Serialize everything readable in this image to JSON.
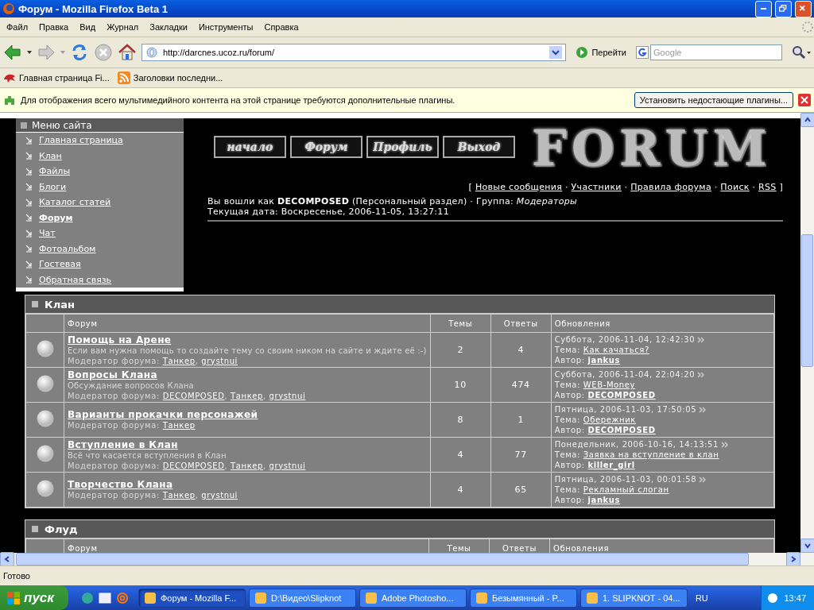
{
  "window": {
    "title": "Форум - Mozilla Firefox Beta 1"
  },
  "menu_bar": [
    "Файл",
    "Правка",
    "Вид",
    "Журнал",
    "Закладки",
    "Инструменты",
    "Справка"
  ],
  "toolbar": {
    "address": "http://darcnes.ucoz.ru/forum/",
    "go_button": "Перейти",
    "search_placeholder": "Google"
  },
  "bookmarks": [
    "Главная страница Fi...",
    "Заголовки последни..."
  ],
  "notification": {
    "message": "Для отображения всего мультимедийного контента на этой странице требуются дополнительные плагины.",
    "button": "Установить недостающие плагины..."
  },
  "site_menu": {
    "title": "Меню сайта",
    "items": [
      {
        "label": "Главная страница",
        "selected": false
      },
      {
        "label": "Клан",
        "selected": false
      },
      {
        "label": "Файлы",
        "selected": false
      },
      {
        "label": "Блоги",
        "selected": false
      },
      {
        "label": "Каталог статей",
        "selected": false
      },
      {
        "label": "Форум",
        "selected": true
      },
      {
        "label": "Чат",
        "selected": false
      },
      {
        "label": "Фотоальбом",
        "selected": false
      },
      {
        "label": "Гостевая",
        "selected": false
      },
      {
        "label": "Обратная связь",
        "selected": false
      }
    ]
  },
  "nav_buttons": [
    "начало",
    "Форум",
    "Профиль",
    "Выход"
  ],
  "logo": "FORUM",
  "forum_links": {
    "open": "[",
    "separator": "·",
    "close": "]",
    "items": [
      "Новые сообщения",
      "Участники",
      "Правила форума",
      "Поиск",
      "RSS"
    ]
  },
  "user_info": "Вы вошли как **DECOMPOSED** (Персональный раздел) · Группа: *Модераторы*",
  "date_line": "Текущая дата: Воскресенье, 2006-11-05, 13:27:11",
  "sections": [
    {
      "title": "Клан",
      "columns": [
        "Форум",
        "Темы",
        "Ответы",
        "Обновления"
      ],
      "forums": [
        {
          "name": "Помощь на Арене",
          "description": "Если вам нужна помощь то создайте тему со своим ником на сайте и ждите её :-)",
          "moderators_label": "Модератор форума:",
          "moderators": [
            "Танкер",
            "grystnui"
          ],
          "moderators_separator": ",",
          "topics": "2",
          "replies": "4",
          "last_date": "Суббота, 2006-11-04, 12:42:30",
          "topic_label": "Тема:",
          "topic": "Как качаться?",
          "author_label": "Автор:",
          "author": "jankus"
        },
        {
          "name": "Вопросы Клана",
          "description": "Обсуждание вопросов Клана",
          "moderators_label": "Модератор форума:",
          "moderators": [
            "DECOMPOSED",
            "Танкер",
            "grystnui"
          ],
          "moderators_separator": ",",
          "topics": "10",
          "replies": "474",
          "last_date": "Суббота, 2006-11-04, 22:04:20",
          "topic_label": "Тема:",
          "topic": "WEB-Money",
          "author_label": "Автор:",
          "author": "DECOMPOSED"
        },
        {
          "name": "Варианты прокачки персонажей",
          "moderators_label": "Модератор форума:",
          "moderators": [
            "Танкер"
          ],
          "topics": "8",
          "replies": "1",
          "last_date": "Пятница, 2006-11-03, 17:50:05",
          "topic_label": "Тема:",
          "topic": "Обережник",
          "author_label": "Автор:",
          "author": "DECOMPOSED"
        },
        {
          "name": "Вступление в Клан",
          "description": "Всё что касается вступления в Клан",
          "moderators_label": "Модератор форума:",
          "moderators": [
            "DECOMPOSED",
            "Танкер",
            "grystnui"
          ],
          "moderators_separator": ",",
          "topics": "4",
          "replies": "77",
          "last_date": "Понедельник, 2006-10-16, 14:13:51",
          "topic_label": "Тема:",
          "topic": "Заявка на вступление в клан",
          "author_label": "Автор:",
          "author": "killer_girl"
        },
        {
          "name": "Творчество Клана",
          "moderators_label": "Модератор форума:",
          "moderators": [
            "Танкер",
            "grystnui"
          ],
          "moderators_separator": ",",
          "topics": "4",
          "replies": "65",
          "last_date": "Пятница, 2006-11-03, 00:01:58",
          "topic_label": "Тема:",
          "topic": "Рекламный слоган",
          "author_label": "Автор:",
          "author": "jankus"
        }
      ]
    },
    {
      "title": "Флуд",
      "columns": [
        "Форум",
        "Темы",
        "Ответы",
        "Обновления"
      ]
    }
  ],
  "status_bar": "Готово",
  "taskbar": {
    "start": "пуск",
    "tasks": [
      {
        "label": "Форум - Mozilla F...",
        "selected": true
      },
      {
        "label": "D:\\Видео\\Slipknot",
        "selected": false
      },
      {
        "label": "Adobe Photosho...",
        "selected": false
      },
      {
        "label": "Безымянный - P...",
        "selected": false
      },
      {
        "label": "1. SLIPKNOT - 04...",
        "selected": false
      }
    ],
    "language": "RU",
    "clock": "13:47"
  }
}
